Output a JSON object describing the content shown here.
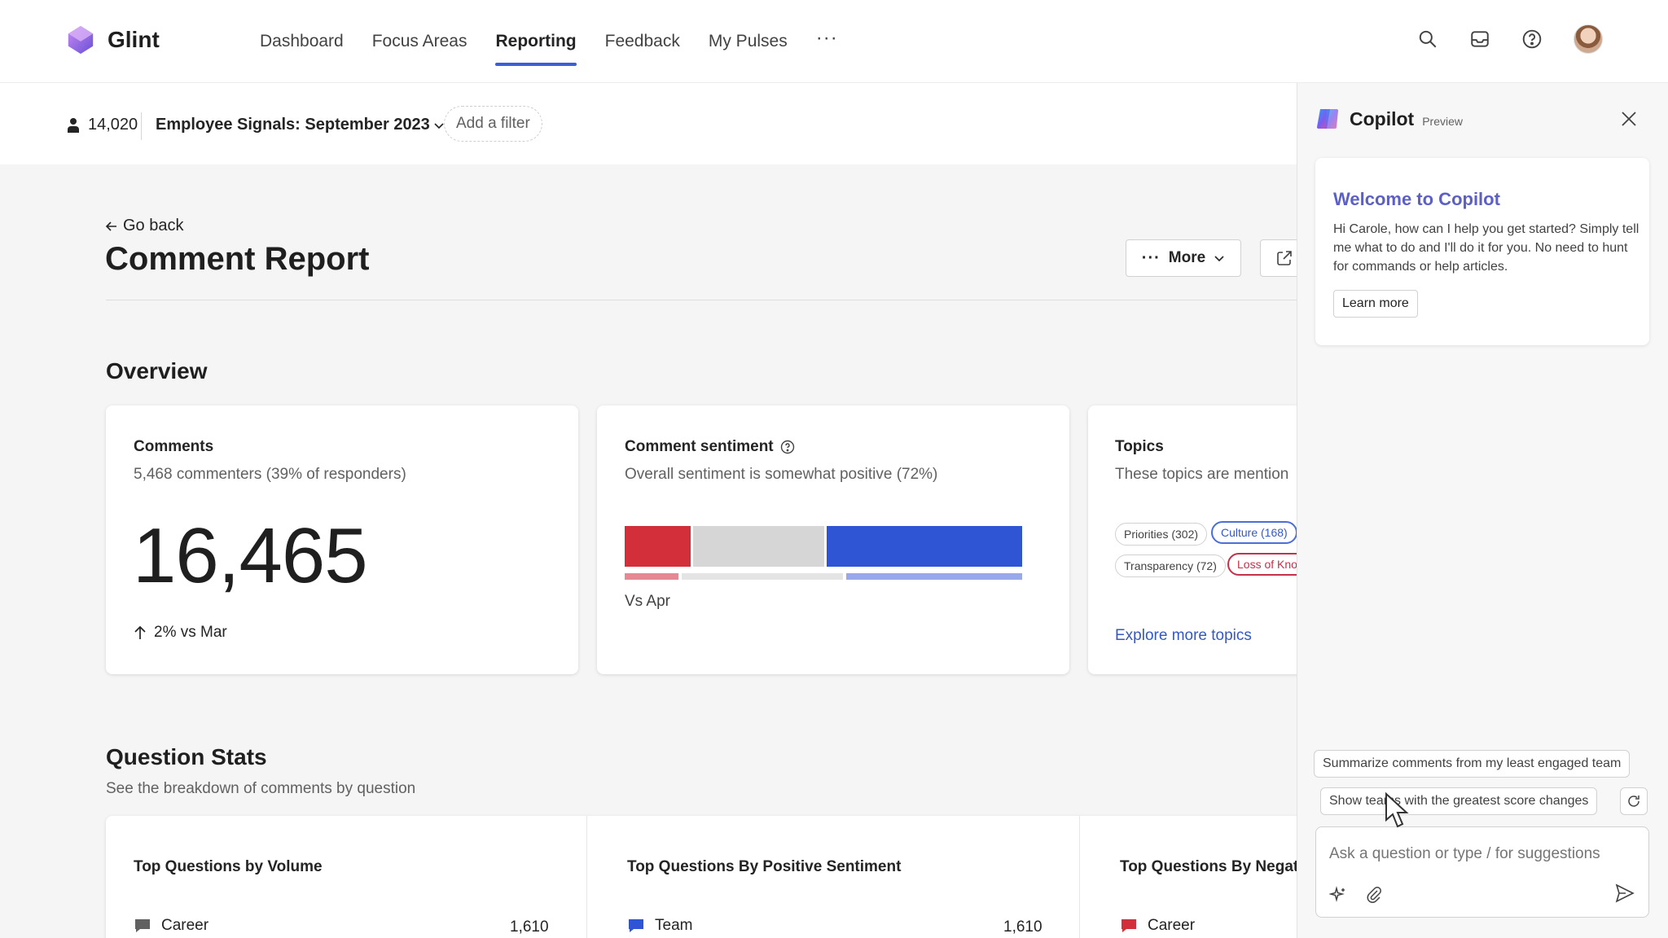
{
  "app": {
    "name": "Glint"
  },
  "nav": {
    "tabs": [
      {
        "label": "Dashboard"
      },
      {
        "label": "Focus Areas"
      },
      {
        "label": "Reporting",
        "active": true
      },
      {
        "label": "Feedback"
      },
      {
        "label": "My Pulses"
      }
    ],
    "more": "···",
    "icons": [
      "search-icon",
      "inbox-icon",
      "help-icon",
      "avatar"
    ]
  },
  "filterbar": {
    "people_count": "14,020",
    "survey": "Employee Signals: September 2023",
    "add_filter": "Add a filter"
  },
  "page": {
    "go_back": "Go back",
    "title": "Comment Report",
    "more_button": "More"
  },
  "overview": {
    "heading": "Overview",
    "comments": {
      "title": "Comments",
      "subtitle": "5,468 commenters (39% of responders)",
      "total": "16,465",
      "trend": "2% vs Mar"
    },
    "sentiment": {
      "title": "Comment sentiment",
      "subtitle": "Overall sentiment is somewhat positive (72%)",
      "compare_label": "Vs Apr",
      "colors": {
        "negative": "#d32f3a",
        "neutral": "#d6d6d6",
        "positive": "#2f55d4"
      }
    },
    "topics": {
      "title": "Topics",
      "subtitle": "These topics are mention",
      "pills": [
        {
          "label": "Priorities (302)",
          "style": "plain"
        },
        {
          "label": "Culture (168)",
          "style": "blue"
        },
        {
          "label": "Transparency (72)",
          "style": "plain"
        },
        {
          "label": "Loss of Kno",
          "style": "red"
        }
      ],
      "link": "Explore more topics"
    }
  },
  "question_stats": {
    "heading": "Question Stats",
    "subtitle": "See the breakdown of comments by question",
    "columns": [
      {
        "title": "Top Questions by Volume",
        "rows": [
          {
            "label": "Career",
            "value": "1,610",
            "color": "#616161"
          }
        ]
      },
      {
        "title": "Top Questions By Positive Sentiment",
        "rows": [
          {
            "label": "Team",
            "value": "1,610",
            "color": "#2f55d4"
          }
        ]
      },
      {
        "title": "Top Questions By Negat",
        "rows": [
          {
            "label": "Career",
            "value": "",
            "color": "#d32f3a"
          }
        ]
      }
    ]
  },
  "copilot": {
    "title": "Copilot",
    "badge": "Preview",
    "welcome_title": "Welcome to Copilot",
    "welcome_body": "Hi Carole, how can I help you get started? Simply tell me what to do and I'll do it for you. No need to hunt for commands or help articles.",
    "learn_more": "Learn more",
    "suggestions": [
      "Summarize comments from my least engaged team",
      "Show teams with the greatest score changes"
    ],
    "input_placeholder": "Ask a question or type / for suggestions"
  }
}
